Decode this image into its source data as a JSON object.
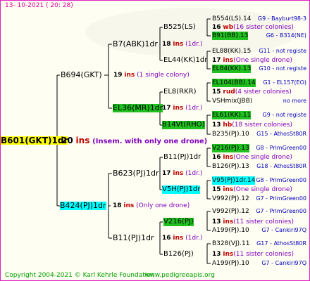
{
  "header": {
    "date": "13-  10-2021  ( 20:  28)"
  },
  "footer": {
    "copyright": "Copyright 2004-2021 © Karl Kehrle Foundation",
    "url": "www.pedigreeapis.org"
  },
  "root": {
    "name": "B601(GKT)1dr",
    "num": "20",
    "ins": "ins",
    "note": "(Insem. with only one drone)"
  },
  "gen1": [
    {
      "name": "B694(GKT)",
      "num": "19",
      "ins": "ins",
      "note": "(1 single colony)"
    },
    {
      "name": "B424(PJ)1dr",
      "num": "18",
      "ins": "ins",
      "note": "(Only one drone)"
    }
  ],
  "gen2": [
    {
      "name": "B7(ABK)1dr",
      "num": "18",
      "ins": "ins",
      "note": "(1dr.)"
    },
    {
      "name": "EL36(MR)1dr",
      "num": "17",
      "ins": "ins",
      "note": "(1dr.)"
    },
    {
      "name": "B623(PJ)1dr",
      "num": "17",
      "ins": "ins",
      "note": "(1dr.)"
    },
    {
      "name": "B11(PJ)1dr",
      "num": "16",
      "ins": "ins",
      "note": "(1dr.)"
    }
  ],
  "gen3": [
    {
      "name": "B525(LS)",
      "num": "16",
      "ins": "wb",
      "note": "(16 sister colonies)"
    },
    {
      "name": "EL44(KK)1dr",
      "num": "17",
      "ins": "ins",
      "note": "(One single drone)"
    },
    {
      "name": "EL8(RKR)",
      "num": "15",
      "ins": "rud",
      "note": "(4 sister colonies)"
    },
    {
      "name": "B14Vt(RHO)",
      "num": "13",
      "ins": "hb",
      "note": "(18 sister colonies)"
    },
    {
      "name": "B11(PJ)1dr",
      "num": "16",
      "ins": "ins",
      "note": "(One single drone)"
    },
    {
      "name": "V5H(PJ)1dr",
      "num": "15",
      "ins": "ins",
      "note": "(One single drone)"
    },
    {
      "name": "V216(PJ)",
      "num": "13",
      "ins": "ins",
      "note": "(11 sister colonies)"
    },
    {
      "name": "B126(PJ)",
      "num": "13",
      "ins": "ins",
      "note": "(11 sister colonies)"
    }
  ],
  "gen4": [
    {
      "name": "B554(LS).14",
      "info": "G9 - Bayburt98-3"
    },
    {
      "name": "B91(BB).13",
      "info": "G6 - B314(NE)"
    },
    {
      "name": "EL88(KK).15",
      "info": "G11 - not registe"
    },
    {
      "name": "EL84(KK).13",
      "info": "G10 - not registe"
    },
    {
      "name": "EL104(BB).14",
      "info": "G1 - EL157(EO)"
    },
    {
      "name": "VSHmix(JBB)",
      "info": "no more"
    },
    {
      "name": "EL61(KK).11",
      "info": "G9 - not registe"
    },
    {
      "name": "B235(PJ).10",
      "info": "G15 - AthosSt80R"
    },
    {
      "name": "V216(PJ).13",
      "info": "G8 - PrimGreen00"
    },
    {
      "name": "B126(PJ).13",
      "info": "G18 - AthosSt80R"
    },
    {
      "name": "V95(PJ)1dr.14",
      "info": "G8 - PrimGreen00"
    },
    {
      "name": "V992(PJ).12",
      "info": "G7 - PrimGreen00"
    },
    {
      "name": "V992(PJ).12",
      "info": "G7 - PrimGreen00"
    },
    {
      "name": "A199(PJ).10",
      "info": "G7 - Cankiri97Q"
    },
    {
      "name": "B328(VJ).11",
      "info": "G17 - AthosSt80R"
    },
    {
      "name": "A199(PJ).10",
      "info": "G7 - Cankiri97Q"
    }
  ]
}
